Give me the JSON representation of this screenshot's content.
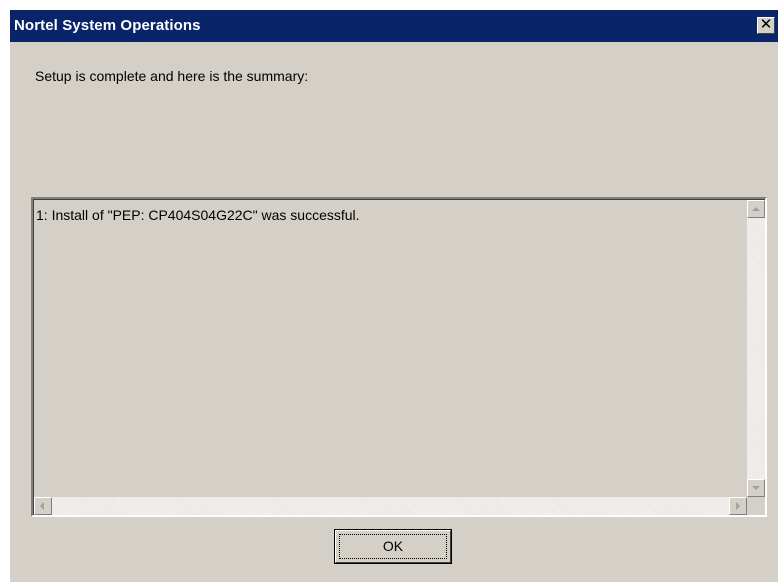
{
  "window": {
    "title": "Nortel System Operations",
    "close_glyph": "✕"
  },
  "main": {
    "summary_label": "Setup is complete and here is the summary:",
    "log_lines": [
      "1: Install of \"PEP: CP404S04G22C\" was successful."
    ]
  },
  "buttons": {
    "ok_label": "OK"
  },
  "icons": {
    "close": "close-icon",
    "scroll_up": "arrow-up-icon",
    "scroll_down": "arrow-down-icon",
    "scroll_left": "arrow-left-icon",
    "scroll_right": "arrow-right-icon"
  },
  "colors": {
    "titlebar": "#0a246a",
    "face": "#d4d0c8",
    "title_text": "#ffffff"
  }
}
